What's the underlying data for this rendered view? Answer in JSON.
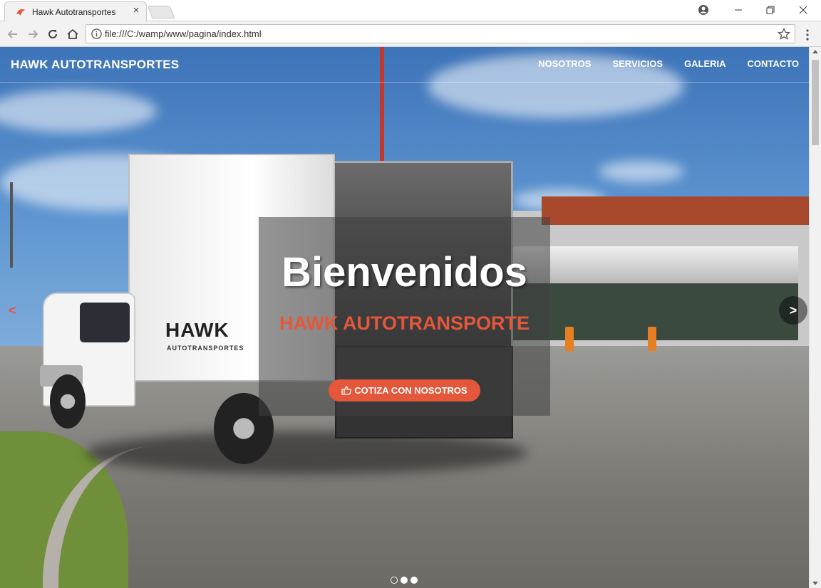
{
  "browser": {
    "tab_title": "Hawk Autotransportes",
    "url": "file:///C:/wamp/www/pagina/index.html"
  },
  "navbar": {
    "brand": "HAWK AUTOTRANSPORTES",
    "links": [
      "NOSOTROS",
      "SERVICIOS",
      "GALERIA",
      "CONTACTO"
    ]
  },
  "hero": {
    "title": "Bienvenidos",
    "subtitle": "HAWK AUTOTRANSPORTE",
    "cta_label": "COTIZA CON NOSOTROS",
    "cta_icon": "thumbs-up-icon",
    "truck_logo": "HAWK",
    "truck_logo_sub": "AUTOTRANSPORTES"
  },
  "carousel": {
    "prev_label": "<",
    "next_label": ">",
    "slide_count": 3,
    "active_index": 0
  },
  "colors": {
    "accent": "#e5573a",
    "caption_bg": "rgba(64,64,64,0.55)"
  }
}
